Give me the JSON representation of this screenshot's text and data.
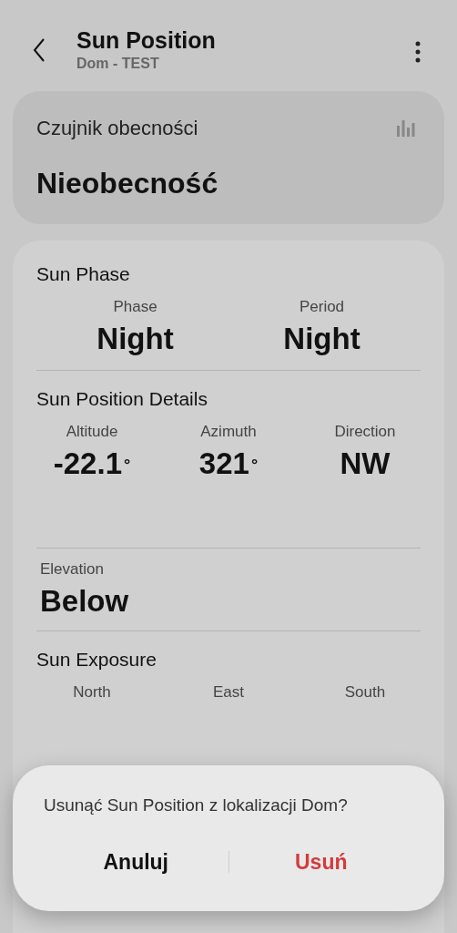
{
  "header": {
    "title": "Sun Position",
    "subtitle": "Dom - TEST"
  },
  "sensor_card": {
    "label": "Czujnik obecności",
    "value": "Nieobecność"
  },
  "sections": [
    {
      "title": "Sun Phase",
      "items": [
        {
          "label": "Phase",
          "value": "Night"
        },
        {
          "label": "Period",
          "value": "Night"
        }
      ]
    },
    {
      "title": "Sun Position Details",
      "items": [
        {
          "label": "Altitude",
          "value": "-22.1",
          "unit": "°"
        },
        {
          "label": "Azimuth",
          "value": "321",
          "unit": "°"
        },
        {
          "label": "Direction",
          "value": "NW"
        }
      ]
    },
    {
      "items": [
        {
          "label": "Elevation",
          "value": "Below"
        }
      ]
    },
    {
      "title": "Sun Exposure",
      "items": [
        {
          "label": "North"
        },
        {
          "label": "East"
        },
        {
          "label": "South"
        }
      ]
    }
  ],
  "dialog": {
    "message": "Usunąć Sun Position z lokalizacji Dom?",
    "buttons": [
      {
        "label": "Anuluj",
        "kind": "cancel"
      },
      {
        "label": "Usuń",
        "kind": "destructive"
      }
    ]
  }
}
